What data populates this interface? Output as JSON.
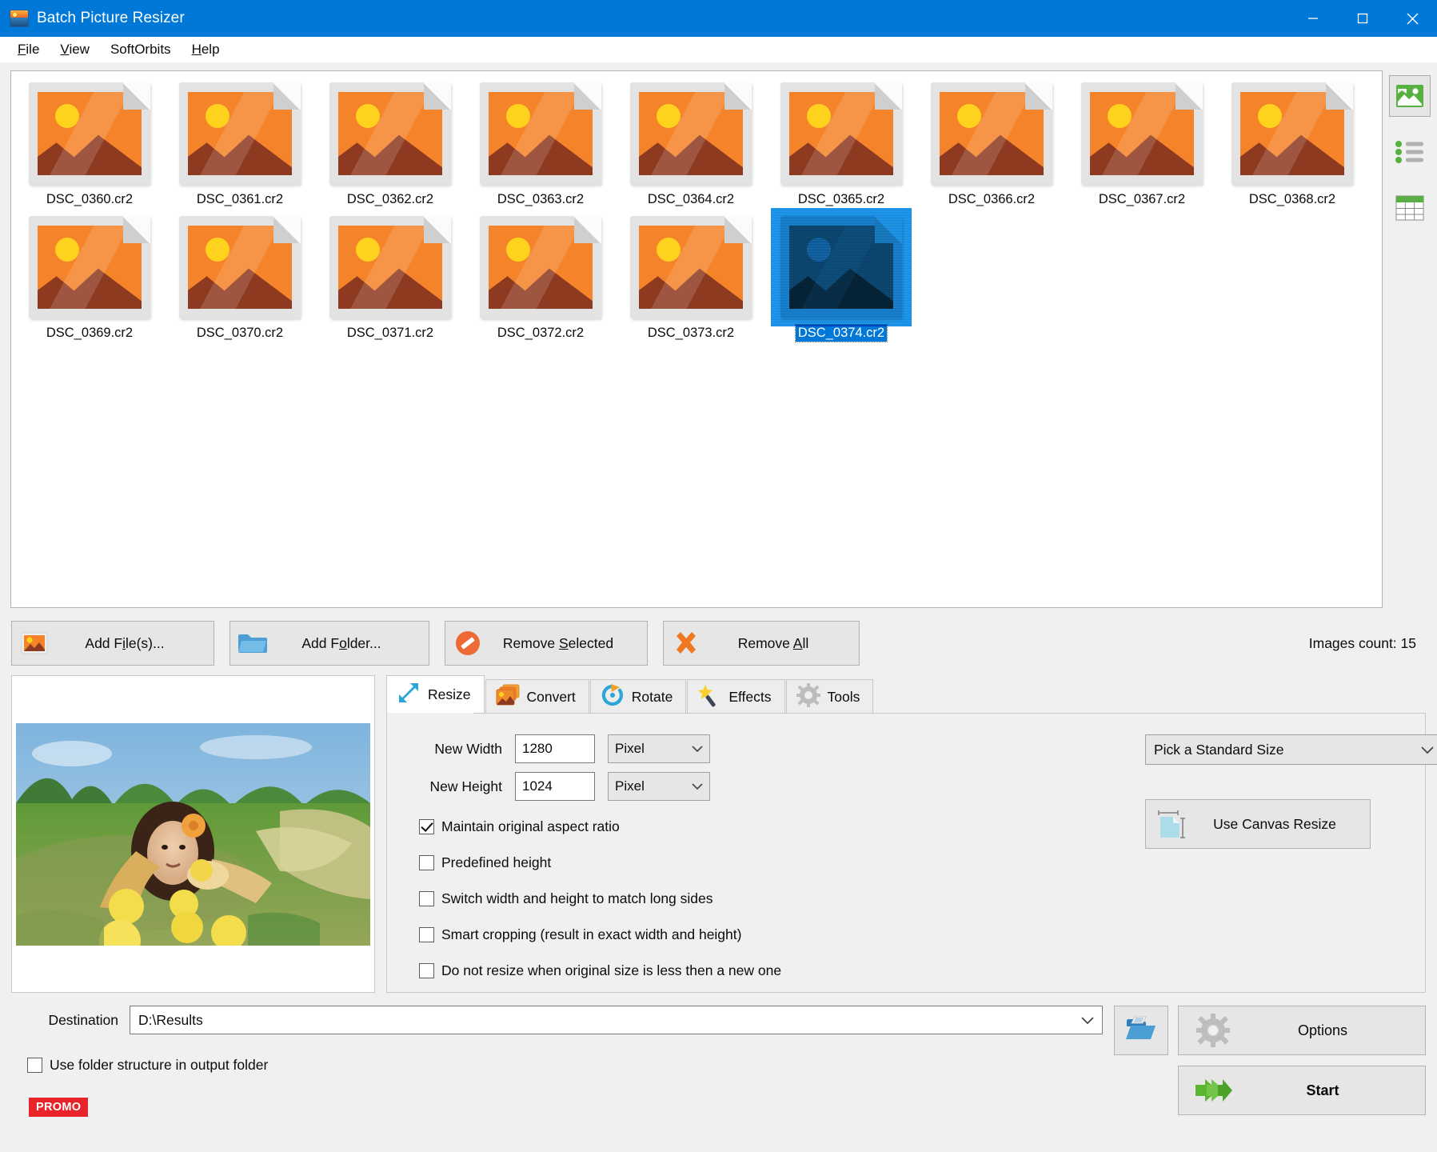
{
  "window": {
    "title": "Batch Picture Resizer",
    "icon": "app-photo-icon",
    "minimize": "minimize-icon",
    "maximize": "maximize-icon",
    "close": "close-icon"
  },
  "menu": {
    "items": [
      {
        "label": "File",
        "accel": "F"
      },
      {
        "label": "View",
        "accel": "V"
      },
      {
        "label": "SoftOrbits",
        "accel": ""
      },
      {
        "label": "Help",
        "accel": "H"
      }
    ]
  },
  "thumbnails": {
    "items": [
      {
        "name": "DSC_0360.cr2",
        "selected": false
      },
      {
        "name": "DSC_0361.cr2",
        "selected": false
      },
      {
        "name": "DSC_0362.cr2",
        "selected": false
      },
      {
        "name": "DSC_0363.cr2",
        "selected": false
      },
      {
        "name": "DSC_0364.cr2",
        "selected": false
      },
      {
        "name": "DSC_0365.cr2",
        "selected": false
      },
      {
        "name": "DSC_0366.cr2",
        "selected": false
      },
      {
        "name": "DSC_0367.cr2",
        "selected": false
      },
      {
        "name": "DSC_0368.cr2",
        "selected": false
      },
      {
        "name": "DSC_0369.cr2",
        "selected": false
      },
      {
        "name": "DSC_0370.cr2",
        "selected": false
      },
      {
        "name": "DSC_0371.cr2",
        "selected": false
      },
      {
        "name": "DSC_0372.cr2",
        "selected": false
      },
      {
        "name": "DSC_0373.cr2",
        "selected": false
      },
      {
        "name": "DSC_0374.cr2",
        "selected": true
      }
    ]
  },
  "view_modes": [
    {
      "name": "thumbnail-view-icon",
      "active": true
    },
    {
      "name": "list-view-icon",
      "active": false
    },
    {
      "name": "details-view-icon",
      "active": false
    }
  ],
  "file_actions": {
    "add_files": "Add File(s)...",
    "add_folder": "Add Folder...",
    "remove_selected": "Remove Selected",
    "remove_all": "Remove All",
    "images_count": "Images count: 15"
  },
  "tabs": [
    {
      "label": "Resize",
      "icon": "resize-arrows-icon",
      "active": true
    },
    {
      "label": "Convert",
      "icon": "convert-images-icon",
      "active": false
    },
    {
      "label": "Rotate",
      "icon": "rotate-arrow-icon",
      "active": false
    },
    {
      "label": "Effects",
      "icon": "magic-wand-icon",
      "active": false
    },
    {
      "label": "Tools",
      "icon": "gear-tools-icon",
      "active": false
    }
  ],
  "resize_panel": {
    "new_width_label": "New Width",
    "new_width_value": "1280",
    "new_width_unit": "Pixel",
    "new_height_label": "New Height",
    "new_height_value": "1024",
    "new_height_unit": "Pixel",
    "standard_size": "Pick a Standard Size",
    "canvas_resize": "Use Canvas Resize",
    "checkboxes": [
      {
        "label": "Maintain original aspect ratio",
        "checked": true
      },
      {
        "label": "Predefined height",
        "checked": false
      },
      {
        "label": "Switch width and height to match long sides",
        "checked": false
      },
      {
        "label": "Smart cropping (result in exact width and height)",
        "checked": false
      },
      {
        "label": "Do not resize when original size is less then a new one",
        "checked": false
      }
    ]
  },
  "destination": {
    "label": "Destination",
    "value": "D:\\Results",
    "use_folder_structure": "Use folder structure in output folder",
    "use_folder_structure_checked": false,
    "promo_badge": "PROMO",
    "browse_icon": "open-folder-icon",
    "options_button": "Options",
    "start_button": "Start"
  },
  "colors": {
    "titlebar": "#0078d7",
    "accent_selection": "#0078d7",
    "promo": "#e8242a",
    "start_arrow": "#5cb531",
    "window_bg": "#f0f0f0"
  }
}
